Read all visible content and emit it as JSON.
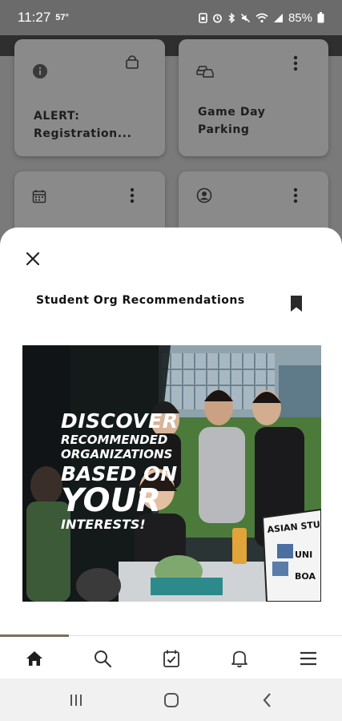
{
  "status_bar": {
    "time": "11:27",
    "temperature": "57°",
    "battery": "85%"
  },
  "background_tiles": [
    {
      "icon": "info-icon",
      "corner_icon": "lock-icon",
      "label_line1": "ALERT:",
      "label_line2": "Registration..."
    },
    {
      "icon": "car-parking-icon",
      "corner_icon": "more-vert-icon",
      "label_line1": "Game Day",
      "label_line2": "Parking"
    },
    {
      "icon": "calendar-icon",
      "corner_icon": "more-vert-icon",
      "label_line1": "",
      "label_line2": ""
    },
    {
      "icon": "profile-icon",
      "corner_icon": "more-vert-icon",
      "label_line1": "",
      "label_line2": ""
    }
  ],
  "sheet": {
    "title": "Student Org Recommendations",
    "promo": {
      "line1": "DISCOVER",
      "line2": "RECOMMENDED",
      "line3": "ORGANIZATIONS",
      "line4": "BASED ON",
      "line5": "YOUR",
      "line6": "INTERESTS!",
      "sign_text": "ASIAN STU UNI BOA"
    }
  },
  "bottom_nav": {
    "items": [
      "home-icon",
      "search-icon",
      "calendar-check-icon",
      "bell-icon",
      "menu-icon"
    ],
    "active": "home-icon"
  },
  "colors": {
    "accent": "#7a6e5e",
    "scrim": "#7a7a7a",
    "sheet": "#ffffff"
  }
}
